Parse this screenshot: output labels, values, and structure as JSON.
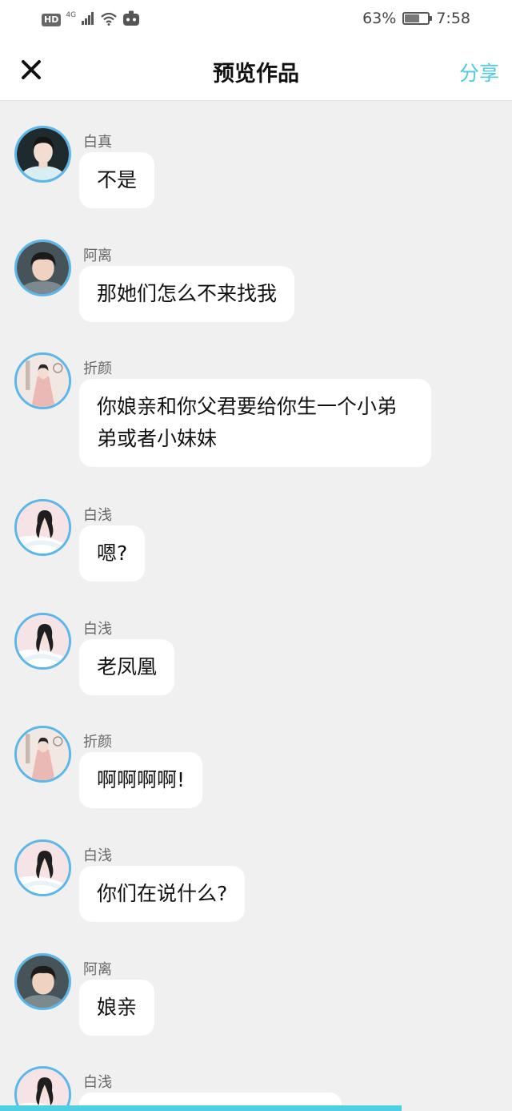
{
  "status_bar": {
    "hd": "HD",
    "network": "4G",
    "battery_percent": "63%",
    "battery_level": 0.63,
    "time": "7:58"
  },
  "header": {
    "close_icon": "close-icon",
    "title": "预览作品",
    "share_label": "分享"
  },
  "colors": {
    "accent": "#4dcbe4",
    "avatar_ring": "#5bb7ea",
    "chat_background": "#f0f0f0",
    "bubble": "#ffffff"
  },
  "messages": [
    {
      "sender": "白真",
      "text": "不是",
      "avatar": "bai-zhen"
    },
    {
      "sender": "阿离",
      "text": "那她们怎么不来找我",
      "avatar": "a-li"
    },
    {
      "sender": "折颜",
      "text": "你娘亲和你父君要给你生一个小弟弟或者小妹妹",
      "avatar": "zhe-yan"
    },
    {
      "sender": "白浅",
      "text": "嗯?",
      "avatar": "bai-qian"
    },
    {
      "sender": "白浅",
      "text": "老凤凰",
      "avatar": "bai-qian"
    },
    {
      "sender": "折颜",
      "text": "啊啊啊啊!",
      "avatar": "zhe-yan"
    },
    {
      "sender": "白浅",
      "text": "你们在说什么?",
      "avatar": "bai-qian"
    },
    {
      "sender": "阿离",
      "text": "娘亲",
      "avatar": "a-li"
    },
    {
      "sender": "白浅",
      "text": "",
      "avatar": "bai-qian"
    }
  ]
}
